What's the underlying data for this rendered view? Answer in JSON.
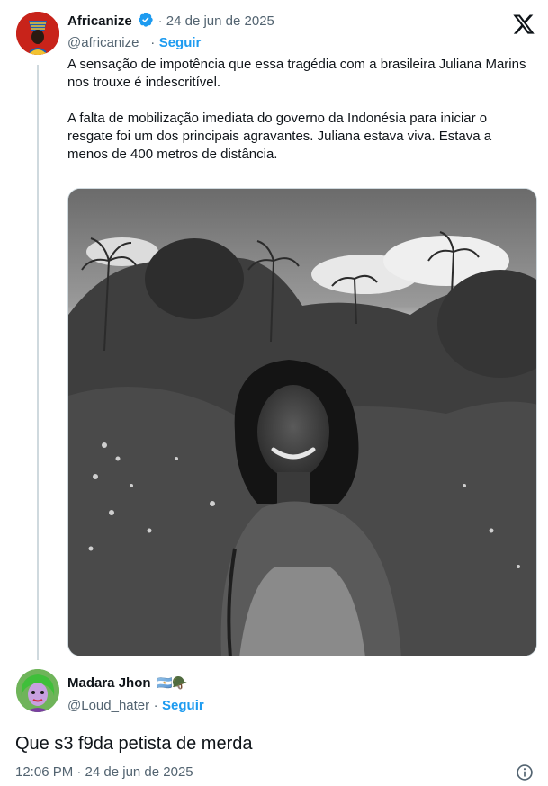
{
  "tweet": {
    "author_name": "Africanize",
    "verified": true,
    "date": "· 24 de jun de 2025",
    "handle": "@africanize_",
    "separator": "·",
    "follow_label": "Seguir",
    "paragraphs": [
      "A sensação de impotência que essa tragédia com a brasileira Juliana Marins nos trouxe é indescritível.",
      "A falta de mobilização imediata do governo da Indonésia para iniciar o resgate foi um dos principais agravantes. Juliana estava viva. Estava a menos de 400 metros de distância."
    ],
    "media_icon": "black-and-white-photo"
  },
  "reply": {
    "author_name": "Madara Jhon",
    "name_emojis": "🇦🇷🪖",
    "handle": "@Loud_hater",
    "separator": "·",
    "follow_label": "Seguir",
    "text": "Que s3 f9da petista de merda",
    "timestamp": "12:06 PM · 24 de jun de 2025"
  },
  "icons": {
    "platform_logo": "x-logo-icon",
    "info": "info-icon",
    "verified": "verified-badge-icon"
  },
  "colors": {
    "link_blue": "#1d9bf0",
    "muted_text": "#536471",
    "thread_line": "#cfd9de"
  }
}
